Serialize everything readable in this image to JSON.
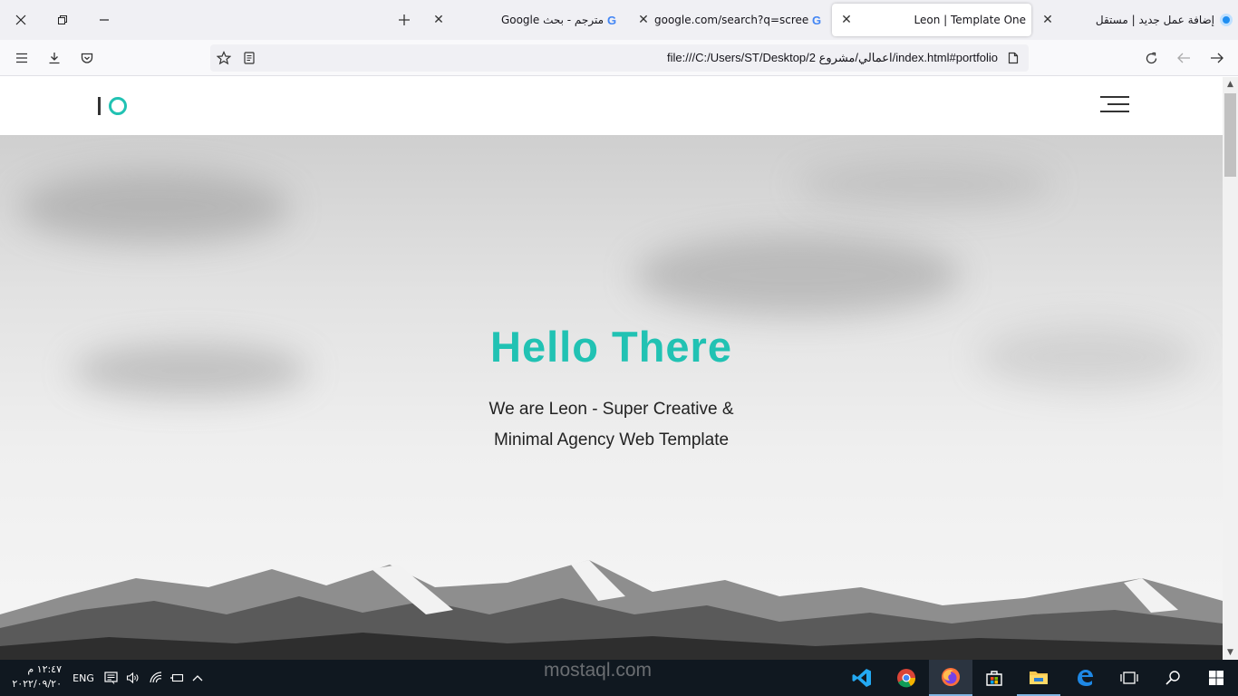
{
  "browser": {
    "tabs": [
      {
        "label": "إضافة عمل جديد | مستقل",
        "active": false
      },
      {
        "label": "Leon | Template One",
        "active": true
      },
      {
        "label": "google.com/search?q=screens",
        "active": false
      },
      {
        "label": "مترجم - بحث Google",
        "active": false
      }
    ],
    "url": "file:///C:/Users/ST/Desktop/2 اعمالي/مشروع/index.html#portfolio"
  },
  "site": {
    "hero": {
      "title": "Hello There",
      "subtitle_line1": "We are Leon - Super Creative &",
      "subtitle_line2": "Minimal Agency Web Template"
    }
  },
  "taskbar": {
    "language": "ENG",
    "time": "١٢:٤٧ م",
    "date": "٢٠٢٢/٠٩/٢٠",
    "watermark": "mostaql.com"
  },
  "colors": {
    "accent": "#21c2b3",
    "taskbar": "#101820"
  }
}
